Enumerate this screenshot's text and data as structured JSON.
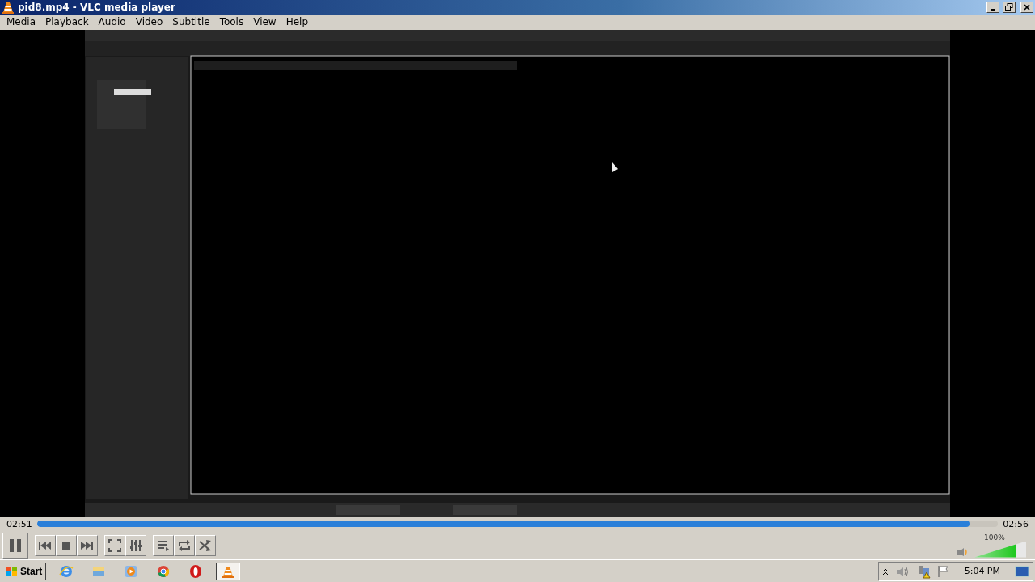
{
  "window": {
    "title": "pid8.mp4 - VLC media player"
  },
  "menu": [
    "Media",
    "Playback",
    "Audio",
    "Video",
    "Subtitle",
    "Tools",
    "View",
    "Help"
  ],
  "seek": {
    "elapsed": "02:51",
    "total": "02:56",
    "level": 0.97
  },
  "volume": {
    "reading": "100%",
    "level": 0.8
  },
  "taskbar": {
    "start": "Start",
    "apps": [
      {
        "kind": "ie",
        "selected": false
      },
      {
        "kind": "folder",
        "selected": false
      },
      {
        "kind": "media",
        "selected": false
      },
      {
        "kind": "chrome",
        "selected": false
      },
      {
        "kind": "opera",
        "selected": false
      },
      {
        "kind": "vlc",
        "selected": true
      }
    ],
    "clock": "5:04 PM"
  }
}
